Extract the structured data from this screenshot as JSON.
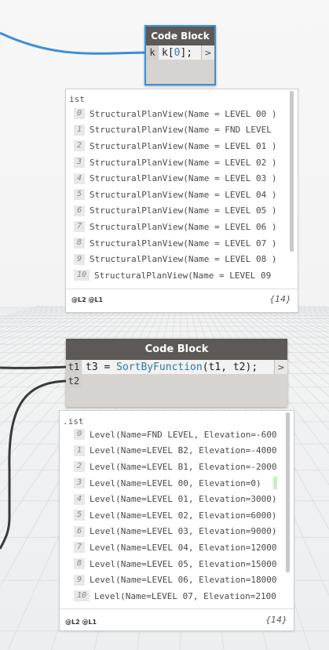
{
  "node1": {
    "title": "Code Block",
    "input_port": "k",
    "code_var": "k",
    "code_open": "[",
    "code_index": "0",
    "code_close": "];",
    "output_port": ">"
  },
  "preview1": {
    "title": "ist",
    "items": [
      {
        "i": "0",
        "text": "StructuralPlanView(Name = LEVEL 00 )"
      },
      {
        "i": "1",
        "text": "StructuralPlanView(Name = FND LEVEL"
      },
      {
        "i": "2",
        "text": "StructuralPlanView(Name = LEVEL 01 )"
      },
      {
        "i": "3",
        "text": "StructuralPlanView(Name = LEVEL 02 )"
      },
      {
        "i": "4",
        "text": "StructuralPlanView(Name = LEVEL 03 )"
      },
      {
        "i": "5",
        "text": "StructuralPlanView(Name = LEVEL 04 )"
      },
      {
        "i": "6",
        "text": "StructuralPlanView(Name = LEVEL 05 )"
      },
      {
        "i": "7",
        "text": "StructuralPlanView(Name = LEVEL 06 )"
      },
      {
        "i": "8",
        "text": "StructuralPlanView(Name = LEVEL 07 )"
      },
      {
        "i": "9",
        "text": "StructuralPlanView(Name = LEVEL 08 )"
      },
      {
        "i": "10",
        "text": "StructuralPlanView(Name = LEVEL 09"
      }
    ],
    "levels": "@L2 @L1",
    "count": "{14}"
  },
  "node2": {
    "title": "Code Block",
    "input_port_1": "t1",
    "input_port_2": "t2",
    "code_assign": "t3 = ",
    "code_fn": "SortByFunction",
    "code_args": "(t1, t2);",
    "output_port": ">"
  },
  "preview2": {
    "title": ".ist",
    "items": [
      {
        "i": "0",
        "text": "Level(Name=FND LEVEL, Elevation=-600"
      },
      {
        "i": "1",
        "text": "Level(Name=LEVEL B2, Elevation=-4000"
      },
      {
        "i": "2",
        "text": "Level(Name=LEVEL B1, Elevation=-2000"
      },
      {
        "i": "3",
        "text": "Level(Name=LEVEL 00, Elevation=0)"
      },
      {
        "i": "4",
        "text": "Level(Name=LEVEL 01, Elevation=3000)"
      },
      {
        "i": "5",
        "text": "Level(Name=LEVEL 02, Elevation=6000)"
      },
      {
        "i": "6",
        "text": "Level(Name=LEVEL 03, Elevation=9000)"
      },
      {
        "i": "7",
        "text": "Level(Name=LEVEL 04, Elevation=12000"
      },
      {
        "i": "8",
        "text": "Level(Name=LEVEL 05, Elevation=15000"
      },
      {
        "i": "9",
        "text": "Level(Name=LEVEL 06, Elevation=18000"
      },
      {
        "i": "10",
        "text": "Level(Name=LEVEL 07, Elevation=2100"
      }
    ],
    "levels": "@L2 @L1",
    "count": "{14}"
  },
  "colors": {
    "wire_selected": "#3d8fd1",
    "wire_default": "#3a3a3a",
    "node_header": "#5c5956",
    "node_selected_border": "#3d8fd1"
  }
}
